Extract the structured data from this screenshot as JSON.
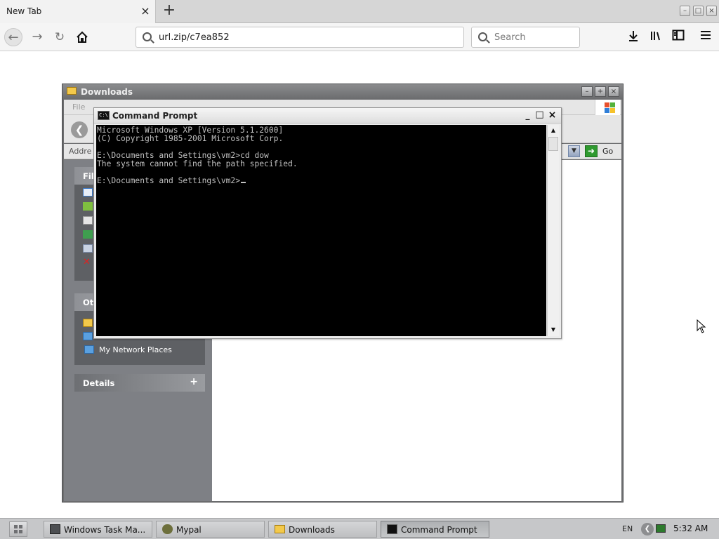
{
  "browser": {
    "tab_title": "New Tab",
    "tab_close": "×",
    "new_tab": "+",
    "url": "url.zip/c7ea852",
    "search_placeholder": "Search",
    "window_controls": {
      "minimize": "–",
      "maximize": "□",
      "close": "×"
    },
    "icons": [
      "back-arrow-icon",
      "forward-arrow-icon",
      "reload-icon",
      "home-icon",
      "download-icon",
      "library-icon",
      "sidebar-icon",
      "menu-icon"
    ]
  },
  "explorer": {
    "title": "Downloads",
    "menu_file": "File",
    "address_label": "Addre",
    "go_label": "Go",
    "panels": {
      "file_tasks": "File",
      "other_places": "Oth",
      "network_places": "My Network Places",
      "details": "Details",
      "details_toggle": "+"
    },
    "controls": {
      "minimize": "–",
      "maximize": "+",
      "close": "×"
    }
  },
  "cmd": {
    "title": "Command Prompt",
    "icon_text": "C:\\",
    "controls": {
      "minimize": "_",
      "maximize": "□",
      "close": "×"
    },
    "lines": [
      "Microsoft Windows XP [Version 5.1.2600]",
      "(C) Copyright 1985-2001 Microsoft Corp.",
      "",
      "E:\\Documents and Settings\\vm2>cd dow",
      "The system cannot find the path specified.",
      "",
      "E:\\Documents and Settings\\vm2>"
    ],
    "scroll_up": "▲",
    "scroll_down": "▼"
  },
  "taskbar": {
    "items": [
      {
        "label": "Windows Task Ma...",
        "icon": "task-manager-icon"
      },
      {
        "label": "Mypal",
        "icon": "mypal-icon"
      },
      {
        "label": "Downloads",
        "icon": "folder-icon"
      },
      {
        "label": "Command Prompt",
        "icon": "cmd-icon",
        "active": true
      }
    ],
    "language": "EN",
    "clock": "5:32 AM"
  },
  "colors": {
    "console_bg": "#000000",
    "console_text": "#c0c0c0",
    "explorer_sidebar": "#7e8085",
    "taskbar": "#c6c7c9"
  }
}
